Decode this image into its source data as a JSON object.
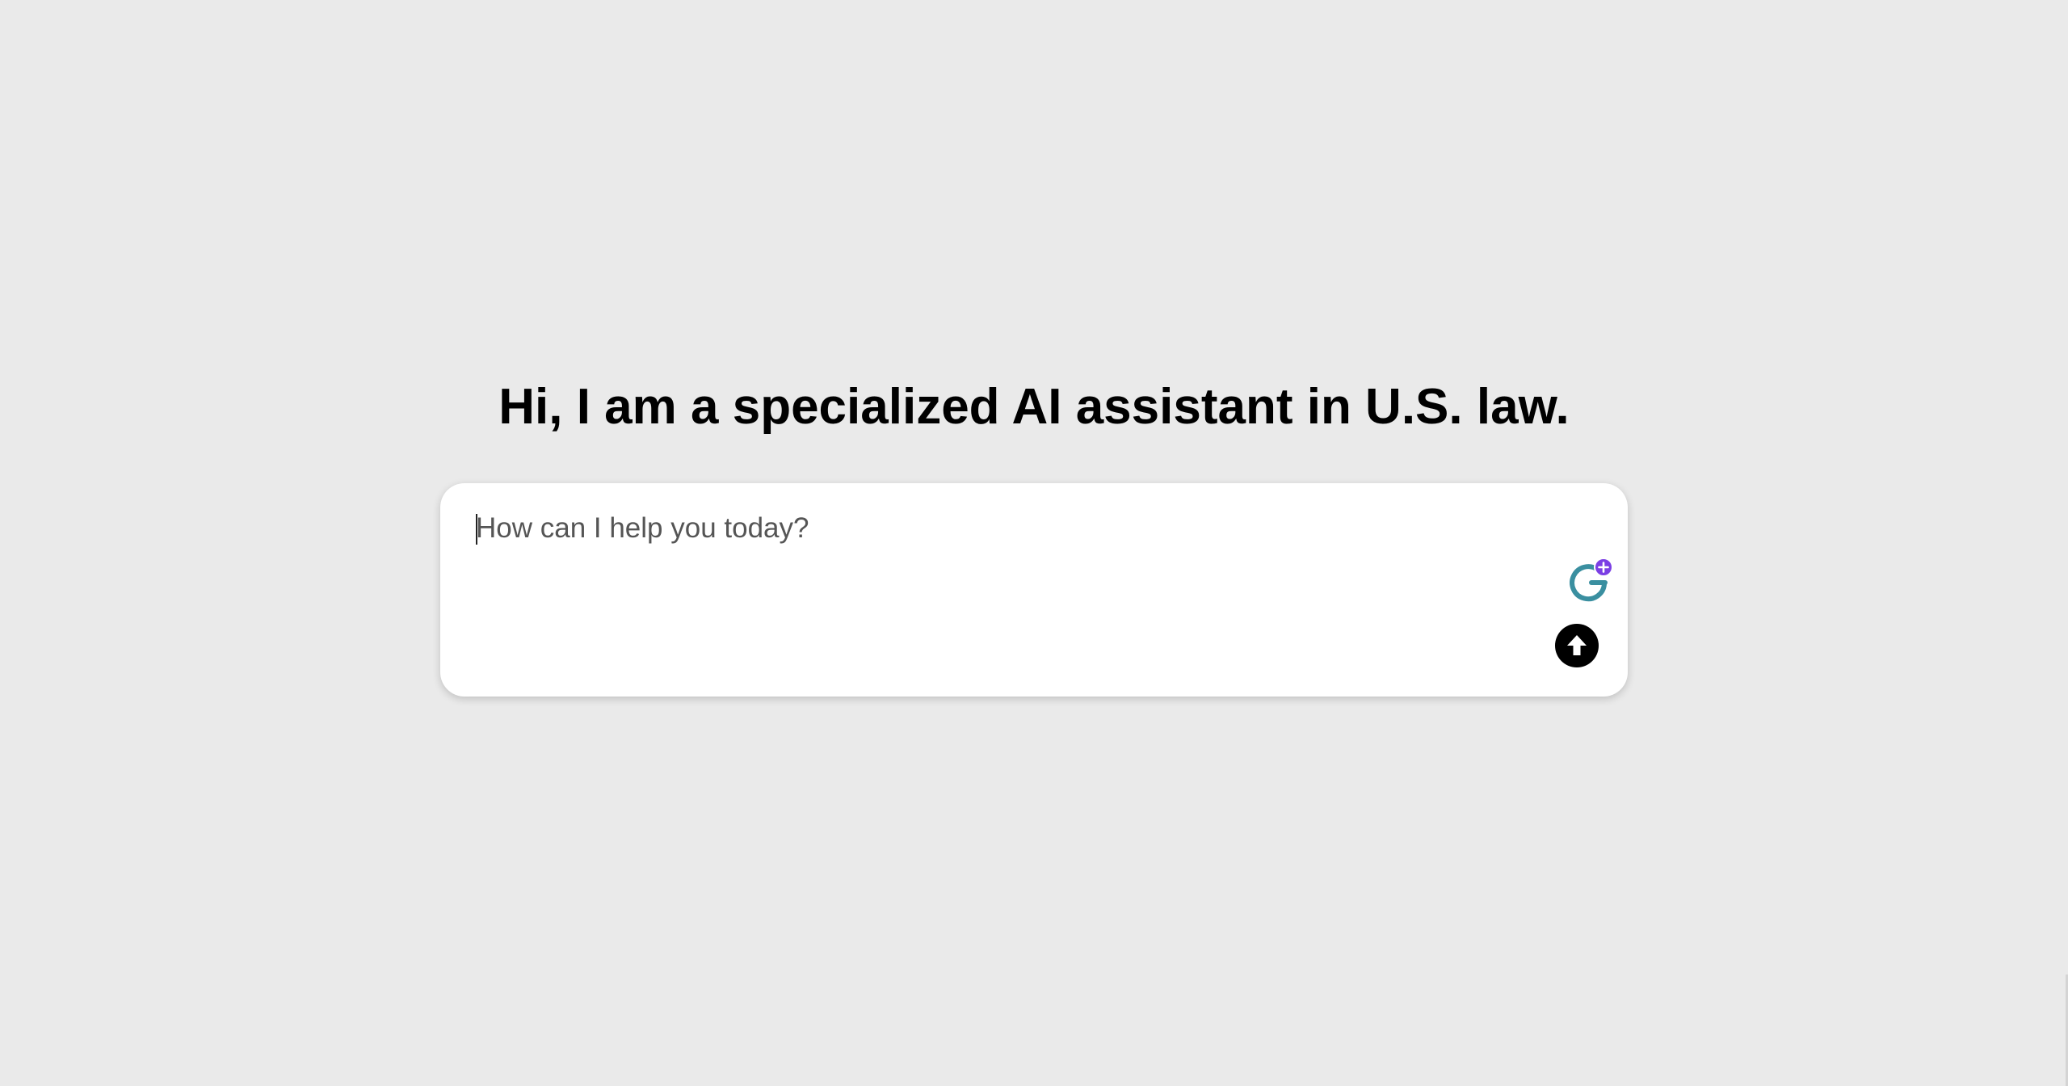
{
  "page": {
    "heading": "Hi, I am a specialized AI assistant in U.S. law."
  },
  "composer": {
    "placeholder": "How can I help you today?",
    "value": "",
    "send_icon": "arrow-up-icon",
    "extension_icon": "grammarly-icon"
  },
  "colors": {
    "background": "#eaeaea",
    "card": "#ffffff",
    "send_button": "#000000",
    "grammarly_teal": "#3a8fa0",
    "grammarly_badge": "#7b3fe4"
  }
}
